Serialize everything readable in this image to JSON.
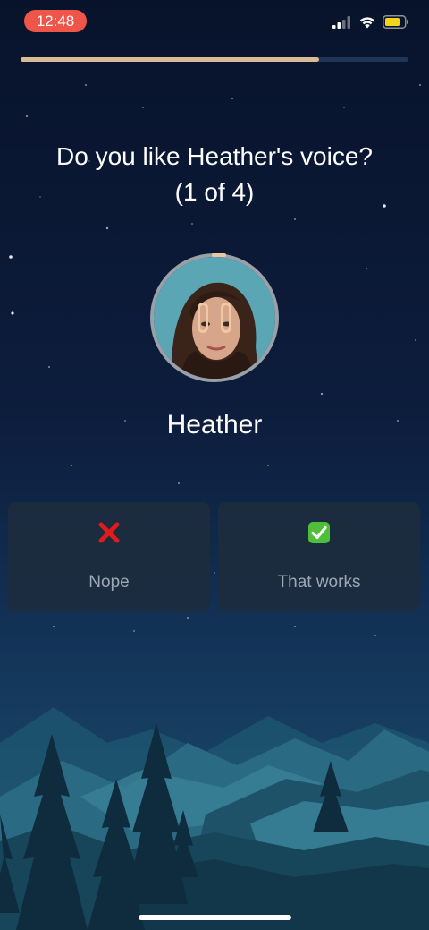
{
  "status_bar": {
    "time": "12:48",
    "icons": [
      "cellular-signal-icon",
      "wifi-icon",
      "battery-icon"
    ],
    "time_pill_color": "#f0554a",
    "battery_color": "#f5d21c"
  },
  "progress": {
    "fraction": 0.77,
    "fill_color": "#d9bb95"
  },
  "question": {
    "line1": "Do you like Heather's voice?",
    "line2": "(1 of 4)"
  },
  "voice": {
    "name": "Heather",
    "playback_icon": "pause-icon"
  },
  "choices": [
    {
      "icon": "red-cross-icon",
      "label": "Nope"
    },
    {
      "icon": "green-check-icon",
      "label": "That works"
    }
  ]
}
